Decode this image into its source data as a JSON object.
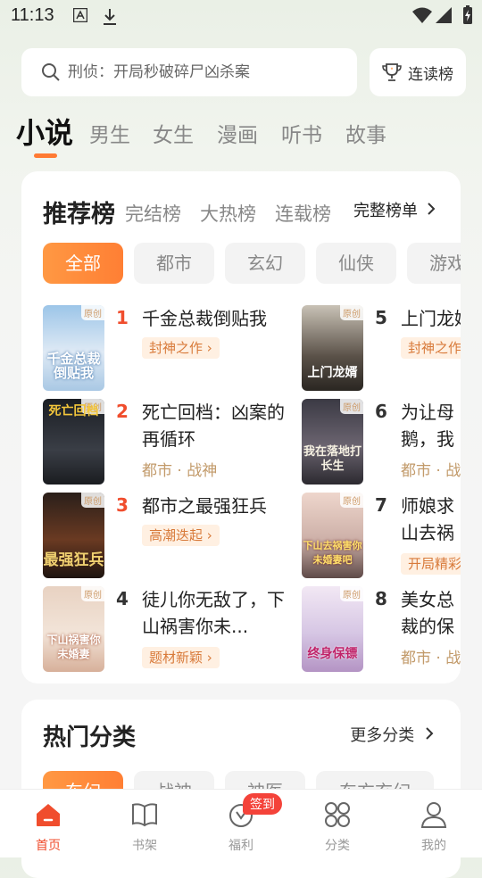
{
  "status_bar": {
    "time": "11:13"
  },
  "search": {
    "placeholder": "刑侦：开局秒破碎尸凶杀案"
  },
  "rank_button": {
    "label": "连读榜"
  },
  "category_tabs": [
    "小说",
    "男生",
    "女生",
    "漫画",
    "听书",
    "故事"
  ],
  "ranking": {
    "tabs": [
      "推荐榜",
      "完结榜",
      "大热榜",
      "连载榜"
    ],
    "full_label": "完整榜单",
    "chips": [
      "全部",
      "都市",
      "玄幻",
      "仙侠",
      "游戏"
    ],
    "books": [
      {
        "rank": "1",
        "title": "千金总裁倒贴我",
        "tag": "封神之作",
        "cover_title": "千金总裁倒贴我",
        "badge": "原创"
      },
      {
        "rank": "2",
        "title": "死亡回档：凶案的再循环",
        "meta": "都市 · 战神",
        "cover_title": "死亡回档",
        "badge": "原创"
      },
      {
        "rank": "3",
        "title": "都市之最强狂兵",
        "tag": "高潮迭起",
        "cover_title": "最强狂兵",
        "badge": "原创"
      },
      {
        "rank": "4",
        "title": "徒儿你无敌了，下山祸害你未...",
        "tag": "题材新颖",
        "cover_title": "下山祸害你未婚妻",
        "badge": "原创"
      },
      {
        "rank": "5",
        "title": "上门龙婿",
        "tag": "封神之作",
        "cover_title": "上门龙婿",
        "badge": "原创"
      },
      {
        "rank": "6",
        "title": "为让母鹅，我",
        "meta": "都市 · 战神",
        "cover_title": "我在落地打长生",
        "badge": "原创"
      },
      {
        "rank": "7",
        "title": "师娘求山去祸",
        "tag": "开局精彩",
        "cover_title": "下山去祸害你未婚妻吧",
        "badge": "原创"
      },
      {
        "rank": "8",
        "title": "美女总裁的保镖",
        "meta": "都市 · 战神",
        "cover_title": "终身保镖",
        "badge": "原创"
      }
    ]
  },
  "hot_categories": {
    "title": "热门分类",
    "more_label": "更多分类",
    "chips": [
      "东幻",
      "战神",
      "神医",
      "东方玄幻"
    ]
  },
  "bottom_nav": [
    {
      "label": "首页",
      "icon": "home-icon"
    },
    {
      "label": "书架",
      "icon": "bookshelf-icon"
    },
    {
      "label": "福利",
      "icon": "welfare-icon"
    },
    {
      "label": "分类",
      "icon": "category-icon"
    },
    {
      "label": "我的",
      "icon": "profile-icon"
    }
  ],
  "sign_badge": "签到",
  "colors": {
    "accent": "#ff7a33",
    "rank_hot": "#f04d2d",
    "tag_bg": "#fff0e2",
    "tag_text": "#d87a3a"
  }
}
